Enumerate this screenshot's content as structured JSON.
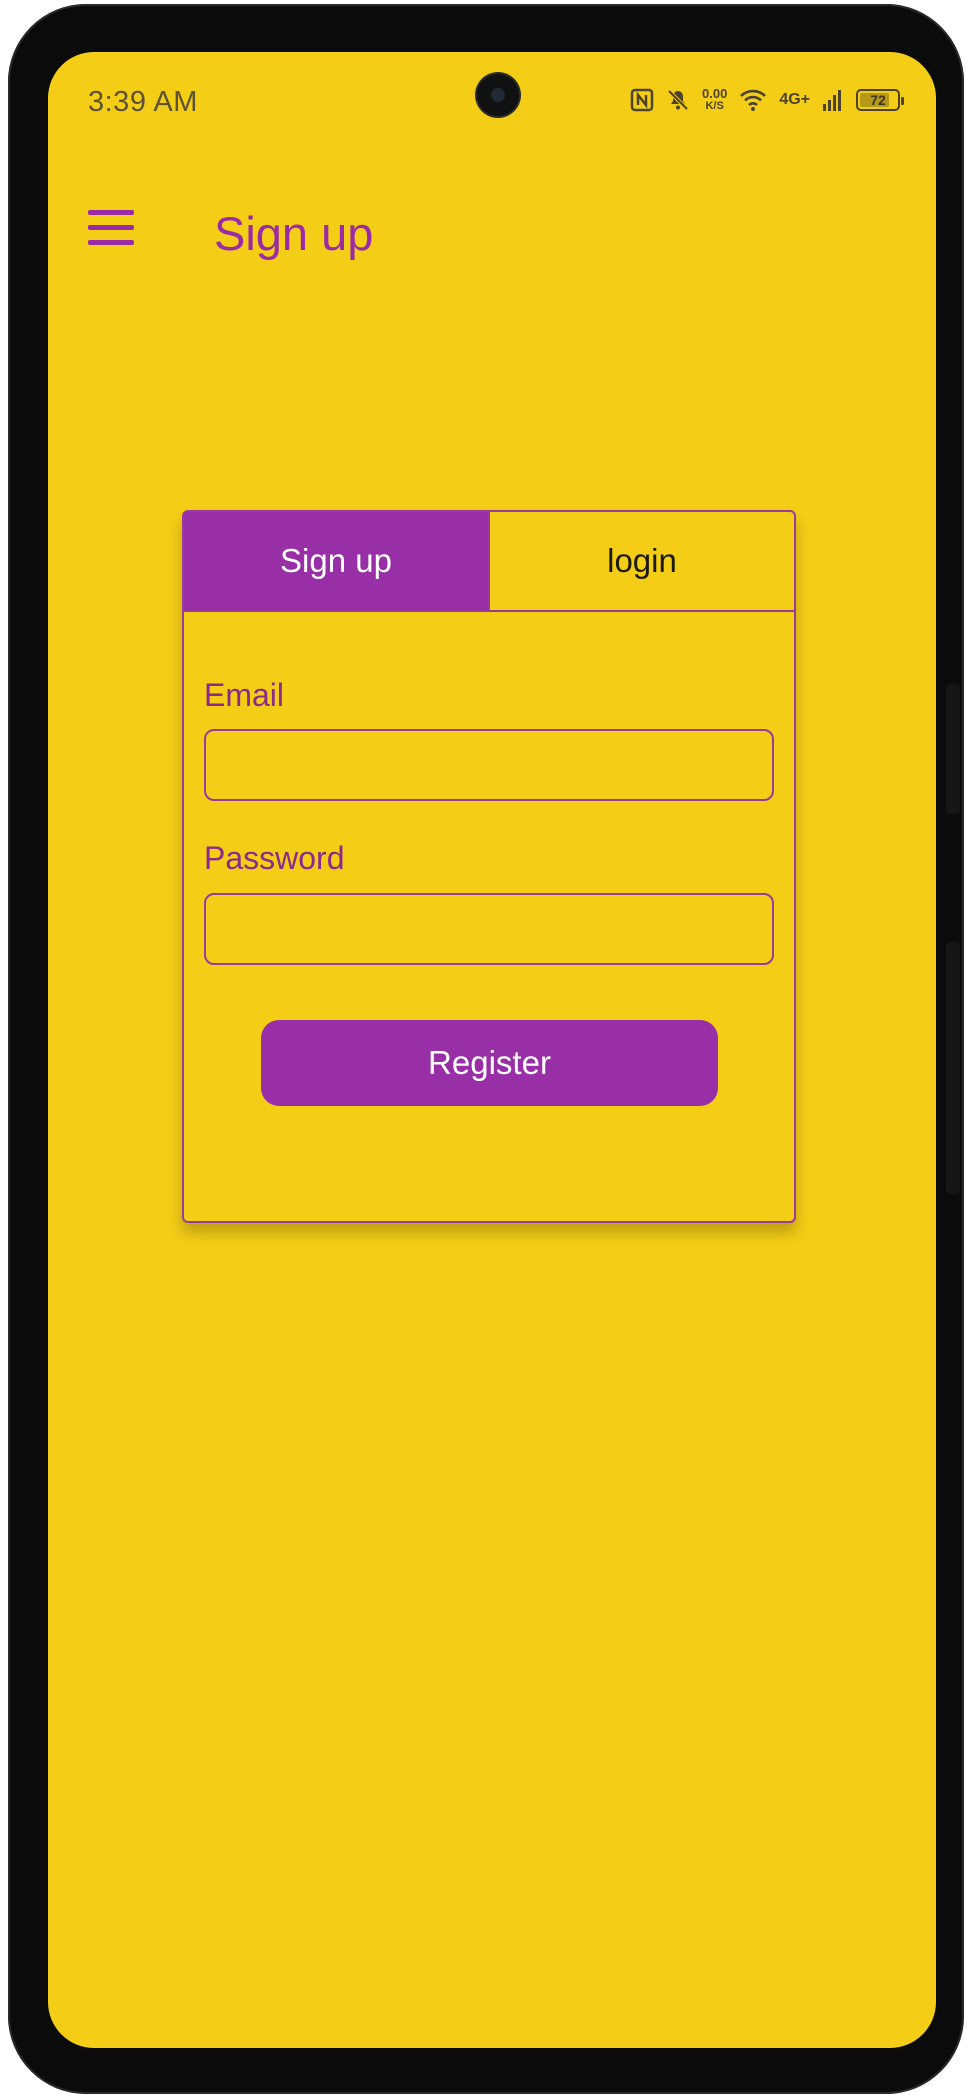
{
  "status_bar": {
    "time": "3:39 AM",
    "net_speed_value": "0.00",
    "net_speed_unit": "K/S",
    "network_type": "4G+",
    "battery_level": "72",
    "icons": [
      "nfc-icon",
      "bell-muted-icon",
      "wifi-icon",
      "signal-icon",
      "battery-icon"
    ]
  },
  "app_bar": {
    "menu_icon": "hamburger-menu-icon",
    "title": "Sign up"
  },
  "form": {
    "tabs": [
      {
        "label": "Sign up",
        "active": true
      },
      {
        "label": "login",
        "active": false
      }
    ],
    "email_label": "Email",
    "email_value": "",
    "password_label": "Password",
    "password_value": "",
    "submit_label": "Register"
  },
  "colors": {
    "background": "#f4cd16",
    "accent": "#982fa7",
    "label": "#8b2a8c"
  }
}
